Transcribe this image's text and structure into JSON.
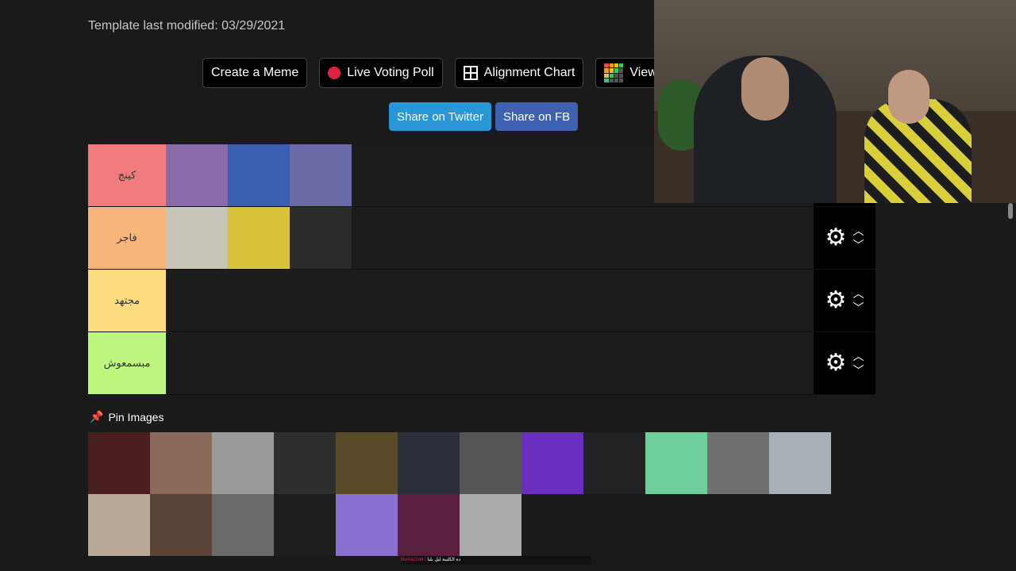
{
  "header": {
    "modified_text": "Template last modified: 03/29/2021"
  },
  "toolbar": {
    "create_meme": "Create a Meme",
    "live_voting": "Live Voting Poll",
    "alignment_chart": "Alignment Chart",
    "view": "View"
  },
  "share": {
    "twitter": "Share on Twitter",
    "facebook": "Share on FB"
  },
  "tiers": [
    {
      "label": "كينج",
      "color": "#f27b7e",
      "images": [
        "#8a6aa8",
        "#3a5fb0",
        "#6b6ba8"
      ]
    },
    {
      "label": "فاجر",
      "color": "#f7b57c",
      "images": [
        "#c9c4b8",
        "#d8c23a",
        "#2a2a2a"
      ]
    },
    {
      "label": "مجتهد",
      "color": "#fcdc7f",
      "images": []
    },
    {
      "label": "مبسمعوش",
      "color": "#bdf77f",
      "images": []
    }
  ],
  "pin": {
    "label": "Pin Images"
  },
  "pool_images": [
    "#4a1e1e",
    "#8a6a5a",
    "#9a9a9a",
    "#2e2e2e",
    "#5a4a2a",
    "#2a2f3a",
    "#555555",
    "#6b2fc0",
    "#222222",
    "#6fcf9a",
    "#707070",
    "#a8b0b8",
    "#b8a898",
    "#5a4438",
    "#6a6a6a",
    "#1e1e1e",
    "#8a70d0",
    "#5a2040",
    "#aaaaaa"
  ],
  "caption": {
    "name": "Bumazzen",
    "text": "دة الكليبة ليل بلبا"
  },
  "colors": {
    "background": "#1a1a1b",
    "twitter": "#2b96d6",
    "facebook": "#4060b0",
    "voting_dot": "#e0243f"
  }
}
